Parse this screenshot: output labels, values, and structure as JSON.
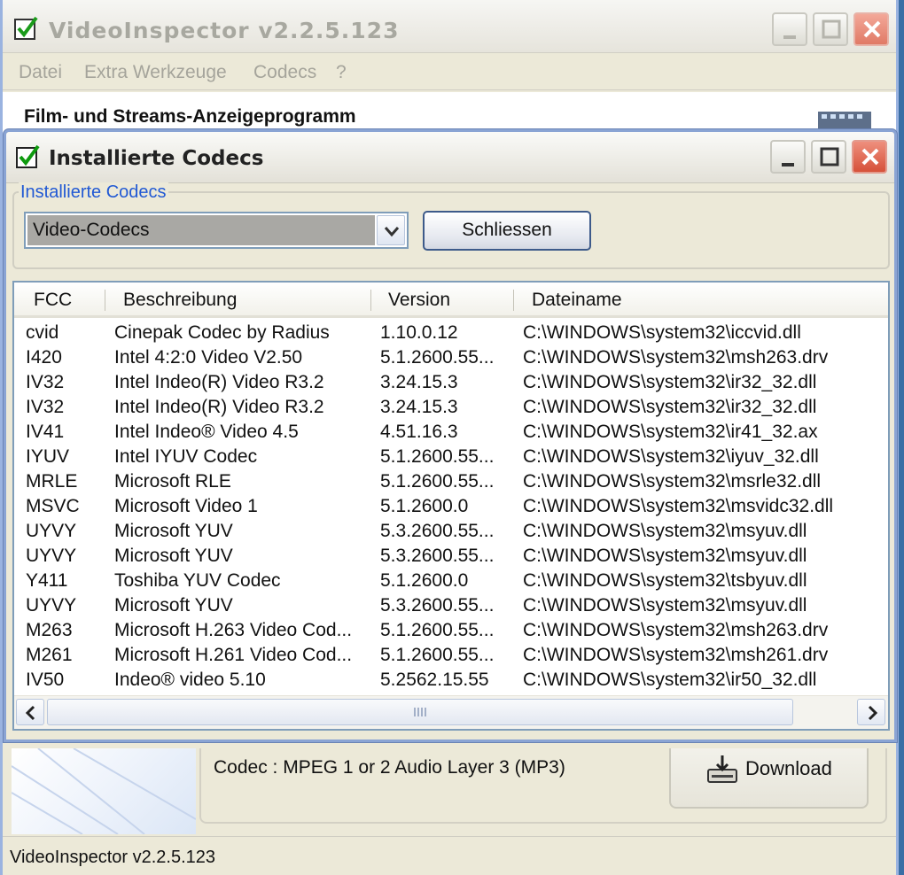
{
  "main_window": {
    "title": "VideoInspector v2.2.5.123",
    "menu": [
      "Datei",
      "Extra Werkzeuge",
      "Codecs",
      "?"
    ],
    "subtitle": "Film- und Streams-Anzeigeprogramm",
    "codec_info": "Codec : MPEG 1 or 2 Audio Layer 3 (MP3)",
    "download_label": "Download",
    "status": "VideoInspector v2.2.5.123"
  },
  "dialog": {
    "title": "Installierte Codecs",
    "group_label": "Installierte Codecs",
    "codec_type": "Video-Codecs",
    "close_label": "Schliessen",
    "columns": [
      "FCC",
      "Beschreibung",
      "Version",
      "Dateiname"
    ],
    "rows": [
      [
        "cvid",
        "Cinepak Codec by Radius",
        "1.10.0.12",
        "C:\\WINDOWS\\system32\\iccvid.dll"
      ],
      [
        "I420",
        "Intel 4:2:0 Video V2.50",
        "5.1.2600.55...",
        "C:\\WINDOWS\\system32\\msh263.drv"
      ],
      [
        "IV32",
        "Intel Indeo(R) Video R3.2",
        "3.24.15.3",
        "C:\\WINDOWS\\system32\\ir32_32.dll"
      ],
      [
        "IV32",
        "Intel Indeo(R) Video R3.2",
        "3.24.15.3",
        "C:\\WINDOWS\\system32\\ir32_32.dll"
      ],
      [
        "IV41",
        "Intel Indeo® Video 4.5",
        "4.51.16.3",
        "C:\\WINDOWS\\system32\\ir41_32.ax"
      ],
      [
        "IYUV",
        "Intel IYUV Codec",
        "5.1.2600.55...",
        "C:\\WINDOWS\\system32\\iyuv_32.dll"
      ],
      [
        "MRLE",
        "Microsoft RLE",
        "5.1.2600.55...",
        "C:\\WINDOWS\\system32\\msrle32.dll"
      ],
      [
        "MSVC",
        "Microsoft Video 1",
        "5.1.2600.0",
        "C:\\WINDOWS\\system32\\msvidc32.dll"
      ],
      [
        "UYVY",
        "Microsoft YUV",
        "5.3.2600.55...",
        "C:\\WINDOWS\\system32\\msyuv.dll"
      ],
      [
        "UYVY",
        "Microsoft YUV",
        "5.3.2600.55...",
        "C:\\WINDOWS\\system32\\msyuv.dll"
      ],
      [
        "Y411",
        "Toshiba YUV Codec",
        "5.1.2600.0",
        "C:\\WINDOWS\\system32\\tsbyuv.dll"
      ],
      [
        "UYVY",
        "Microsoft YUV",
        "5.3.2600.55...",
        "C:\\WINDOWS\\system32\\msyuv.dll"
      ],
      [
        "M263",
        "Microsoft H.263 Video Cod...",
        "5.1.2600.55...",
        "C:\\WINDOWS\\system32\\msh263.drv"
      ],
      [
        "M261",
        "Microsoft H.261 Video Cod...",
        "5.1.2600.55...",
        "C:\\WINDOWS\\system32\\msh261.drv"
      ],
      [
        "IV50",
        "Indeo® video 5.10",
        "5.2562.15.55",
        "C:\\WINDOWS\\system32\\ir50_32.dll"
      ]
    ]
  },
  "colors": {
    "group_label": "#2159d4",
    "close_caption": "#e07a66",
    "desktop": "#3a6ea5"
  },
  "icons": [
    "app-check-icon",
    "minimize-icon",
    "maximize-icon",
    "close-icon",
    "film-icon",
    "dropdown-arrow-icon",
    "download-icon",
    "scroll-left-icon",
    "scroll-right-icon"
  ]
}
